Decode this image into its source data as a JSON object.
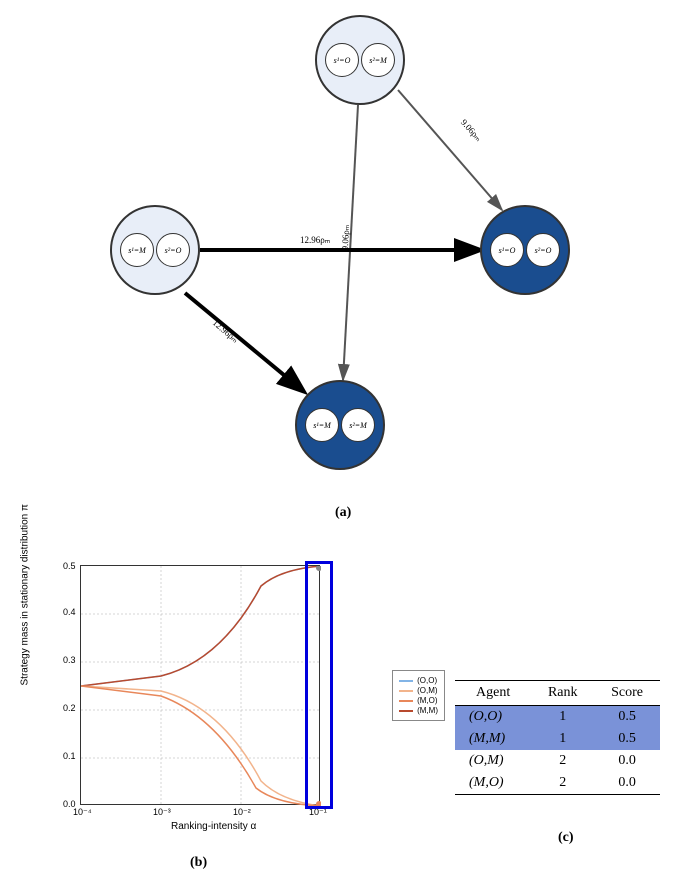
{
  "panel_a": {
    "caption": "(a)",
    "nodes": {
      "top": {
        "s1": "s¹=O",
        "s2": "s²=M"
      },
      "left": {
        "s1": "s¹=M",
        "s2": "s²=O"
      },
      "right": {
        "s1": "s¹=O",
        "s2": "s²=O"
      },
      "bottom": {
        "s1": "s¹=M",
        "s2": "s²=M"
      }
    },
    "edges": {
      "top_right": "9.06ρₘ",
      "top_bottom": "9.06ρₘ",
      "left_right": "12.96ρₘ",
      "left_bottom": "12.96ρₘ"
    }
  },
  "panel_b": {
    "caption": "(b)",
    "ylabel": "Strategy mass in stationary distribution π",
    "xlabel": "Ranking-intensity α",
    "xticks": [
      "10⁻⁴",
      "10⁻³",
      "10⁻²",
      "10⁻¹"
    ],
    "yticks": [
      "0.0",
      "0.1",
      "0.2",
      "0.3",
      "0.4",
      "0.5"
    ],
    "legend": [
      "(O,O)",
      "(O,M)",
      "(M,O)",
      "(M,M)"
    ]
  },
  "panel_c": {
    "caption": "(c)",
    "headers": [
      "Agent",
      "Rank",
      "Score"
    ],
    "rows": [
      {
        "agent": "(O,O)",
        "rank": "1",
        "score": "0.5",
        "highlight": true
      },
      {
        "agent": "(M,M)",
        "rank": "1",
        "score": "0.5",
        "highlight": true
      },
      {
        "agent": "(O,M)",
        "rank": "2",
        "score": "0.0",
        "highlight": false
      },
      {
        "agent": "(M,O)",
        "rank": "2",
        "score": "0.0",
        "highlight": false
      }
    ]
  },
  "chart_data": {
    "type": "line",
    "xlabel": "Ranking-intensity α",
    "ylabel": "Strategy mass in stationary distribution π",
    "x_scale": "log",
    "xlim": [
      0.0001,
      0.1
    ],
    "ylim": [
      0.0,
      0.5
    ],
    "series": [
      {
        "name": "(O,O)",
        "color": "#82b4e6",
        "x": [
          0.0001,
          0.001,
          0.003,
          0.01,
          0.03,
          0.05,
          0.08,
          0.1
        ],
        "y": [
          0.25,
          0.27,
          0.3,
          0.38,
          0.47,
          0.49,
          0.5,
          0.5
        ]
      },
      {
        "name": "(O,M)",
        "color": "#f2b48c",
        "x": [
          0.0001,
          0.001,
          0.003,
          0.01,
          0.03,
          0.05,
          0.08,
          0.1
        ],
        "y": [
          0.25,
          0.24,
          0.22,
          0.15,
          0.05,
          0.02,
          0.0,
          0.0
        ]
      },
      {
        "name": "(M,O)",
        "color": "#e8875a",
        "x": [
          0.0001,
          0.001,
          0.003,
          0.01,
          0.03,
          0.05,
          0.08,
          0.1
        ],
        "y": [
          0.25,
          0.23,
          0.2,
          0.11,
          0.03,
          0.01,
          0.0,
          0.0
        ]
      },
      {
        "name": "(M,M)",
        "color": "#b84a2e",
        "x": [
          0.0001,
          0.001,
          0.003,
          0.01,
          0.03,
          0.05,
          0.08,
          0.1
        ],
        "y": [
          0.25,
          0.27,
          0.3,
          0.38,
          0.47,
          0.49,
          0.5,
          0.5
        ]
      }
    ]
  }
}
